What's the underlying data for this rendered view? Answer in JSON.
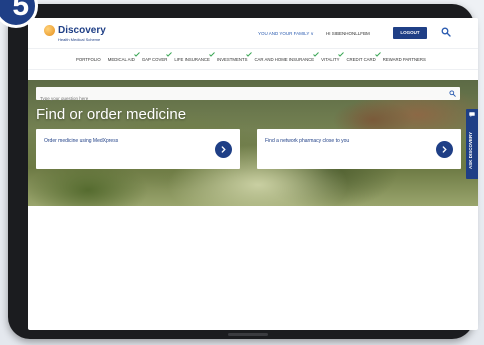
{
  "step_badge": "5",
  "header": {
    "brand": "Discovery",
    "brand_sub": "Health Medical Scheme",
    "family_link": "YOU AND YOUR FAMILY ∨",
    "greeting": "HI SIBENHONLLFBM",
    "logout_label": "LOGOUT"
  },
  "nav": {
    "items": [
      "PORTFOLIO",
      "MEDICAL AID",
      "GAP COVER",
      "LIFE INSURANCE",
      "INVESTMENTS",
      "CAR AND HOME INSURANCE",
      "VITALITY",
      "CREDIT CARD",
      "REWARD PARTNERS"
    ]
  },
  "hero": {
    "search_placeholder": "Type your question here",
    "title": "Find or order medicine",
    "cards": [
      {
        "label": "Order medicine using MedXpress"
      },
      {
        "label": "Find a network pharmacy close to you"
      }
    ]
  },
  "ask_tab": {
    "label": "ASK DISCOVERY"
  },
  "colors": {
    "brand_blue": "#1f3f86",
    "logo_orange": "#e58f1c"
  }
}
